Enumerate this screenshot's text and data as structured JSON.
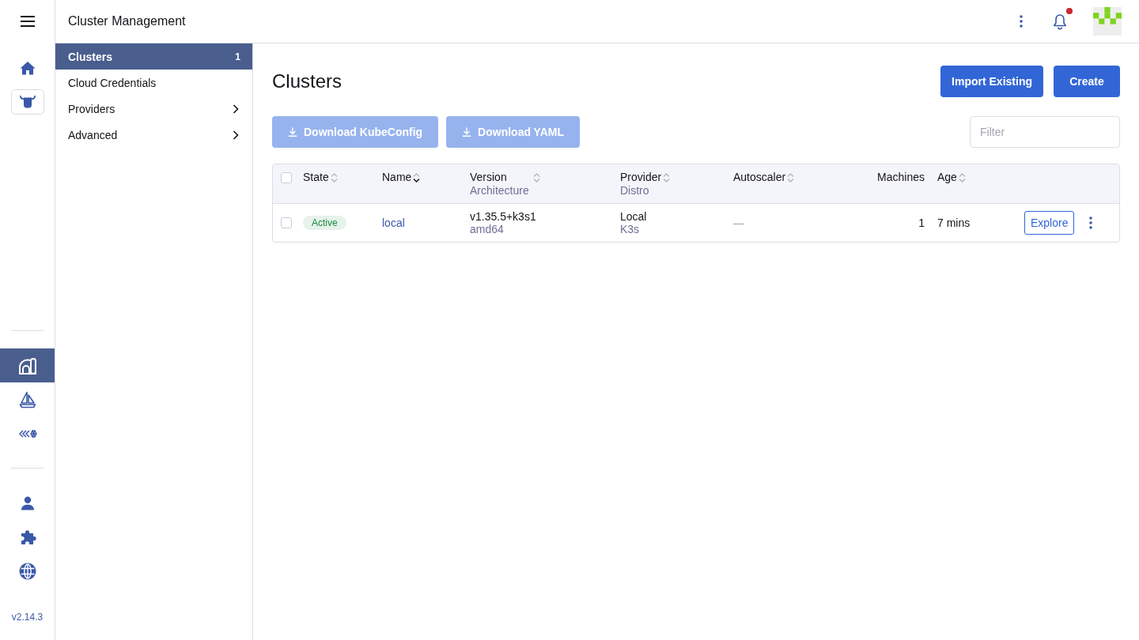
{
  "nav_rail": {
    "groups": [
      {
        "items": [
          {
            "selected": false
          },
          {
            "selected": false
          }
        ]
      },
      {
        "items": [
          {
            "selected": true
          },
          {
            "selected": false
          },
          {
            "selected": false
          }
        ]
      },
      {
        "items": [
          {
            "selected": false
          },
          {
            "selected": false
          },
          {
            "selected": false
          }
        ]
      }
    ],
    "version": "v2.14.3"
  },
  "top_bar": {
    "title": "Cluster Management",
    "notifications": {
      "unread": true
    }
  },
  "sidebar": {
    "items": [
      {
        "kind": "link",
        "label": "Clusters",
        "count": "1",
        "selected": true
      },
      {
        "kind": "link",
        "label": "Cloud Credentials",
        "selected": false
      },
      {
        "kind": "group",
        "label": "Providers",
        "selected": false
      },
      {
        "kind": "group",
        "label": "Advanced",
        "selected": false
      }
    ]
  },
  "page": {
    "title": "Clusters",
    "actions": [
      {
        "label": "Import Existing"
      },
      {
        "label": "Create"
      }
    ],
    "bulk_actions": [
      {
        "label": "Download KubeConfig",
        "disabled": true
      },
      {
        "label": "Download YAML",
        "disabled": true
      }
    ],
    "filter": {
      "placeholder": "Filter"
    }
  },
  "table": {
    "select_all": {
      "checked": false
    },
    "columns": [
      {
        "label": "State",
        "sortable": true,
        "sorted": false
      },
      {
        "label": "Name",
        "sortable": true,
        "sorted": true
      },
      {
        "label": "Version",
        "sublabel": "Architecture",
        "sortable": true,
        "sorted": false
      },
      {
        "label": "Provider",
        "sublabel": "Distro",
        "sortable": true,
        "sorted": false
      },
      {
        "label": "Autoscaler",
        "sortable": true,
        "sorted": false
      },
      {
        "label": "Machines",
        "sortable": false
      },
      {
        "label": "Age",
        "sortable": true,
        "sorted": false
      }
    ],
    "rows": [
      {
        "checked": false,
        "state": {
          "label": "Active",
          "color": "#1d8a3f"
        },
        "name": "local",
        "version": "v1.35.5+k3s1",
        "architecture": "amd64",
        "provider": "Local",
        "distro": "K3s",
        "autoscaler": "—",
        "machines": "1",
        "age": "7 mins",
        "action": "Explore"
      }
    ]
  }
}
